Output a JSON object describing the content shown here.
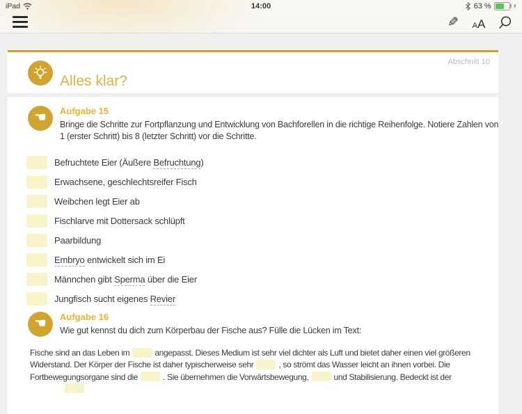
{
  "status_bar": {
    "device": "iPad",
    "time": "14:00",
    "battery_percent": "63 %"
  },
  "toolbar": {
    "text_size_small": "A",
    "text_size_large": "A"
  },
  "header": {
    "section_label": "Abschnitt 10",
    "title": "Alles klar?"
  },
  "tasks": [
    {
      "label": "Aufgabe 15",
      "instruction": "Bringe die Schritte zur Fortpflanzung und Entwicklung von Bachforellen in die richtige Reihenfolge. Notiere Zahlen von 1 (erster Schritt) bis 8 (letzter Schritt) vor die Schritte.",
      "items": [
        {
          "segments": [
            {
              "t": "Befruchtete Eier (Äußere "
            },
            {
              "t": "Befruchtung",
              "gloss": true
            },
            {
              "t": ")"
            }
          ]
        },
        {
          "segments": [
            {
              "t": "Erwachsene, geschlechtsreifer Fisch"
            }
          ]
        },
        {
          "segments": [
            {
              "t": "Weibchen legt Eier ab"
            }
          ]
        },
        {
          "segments": [
            {
              "t": "Fischlarve mit Dottersack schlüpft"
            }
          ]
        },
        {
          "segments": [
            {
              "t": "Paarbildung"
            }
          ]
        },
        {
          "segments": [
            {
              "t": "Embryo",
              "gloss": true
            },
            {
              "t": " entwickelt sich im Ei"
            }
          ]
        },
        {
          "segments": [
            {
              "t": "Männchen gibt "
            },
            {
              "t": "Sperma",
              "gloss": true
            },
            {
              "t": " über die Eier"
            }
          ]
        },
        {
          "segments": [
            {
              "t": "Jungfisch sucht eigenes "
            },
            {
              "t": "Revier",
              "gloss": true
            }
          ]
        }
      ]
    },
    {
      "label": "Aufgabe 16",
      "instruction": "Wie gut kennst du dich zum Körperbau der Fische aus? Fülle die Lücken im Text:",
      "paragraph": [
        {
          "t": "Fische sind an das Leben im"
        },
        {
          "blank": true
        },
        {
          "t": "angepasst. Dieses Medium ist sehr viel dichter als Luft und bietet daher einen viel größeren"
        },
        {
          "br": true
        },
        {
          "t": "Widerstand. Der Körper der Fische ist daher typischerweise sehr"
        },
        {
          "blank": true
        },
        {
          "t": ", so strömt das Wasser leicht an ihnen vorbei. Die"
        },
        {
          "br": true
        },
        {
          "t": "Fortbewegungsorgane sind die"
        },
        {
          "blank": true
        },
        {
          "t": ". Sie übernehmen die Vorwärtsbewegung,"
        },
        {
          "blank": true
        },
        {
          "t": "und Stabilisierung. Bedeckt ist der"
        },
        {
          "br": true
        },
        {
          "blank": true,
          "indent": true
        }
      ]
    }
  ],
  "colors": {
    "accent_border": "#c9a42f",
    "icon_circle": "#d0a42e",
    "title_gold": "#ddb143",
    "task_label_gold": "#e9b232",
    "blank_fill": "#f8f3c9",
    "battery_green": "#54c75b"
  }
}
